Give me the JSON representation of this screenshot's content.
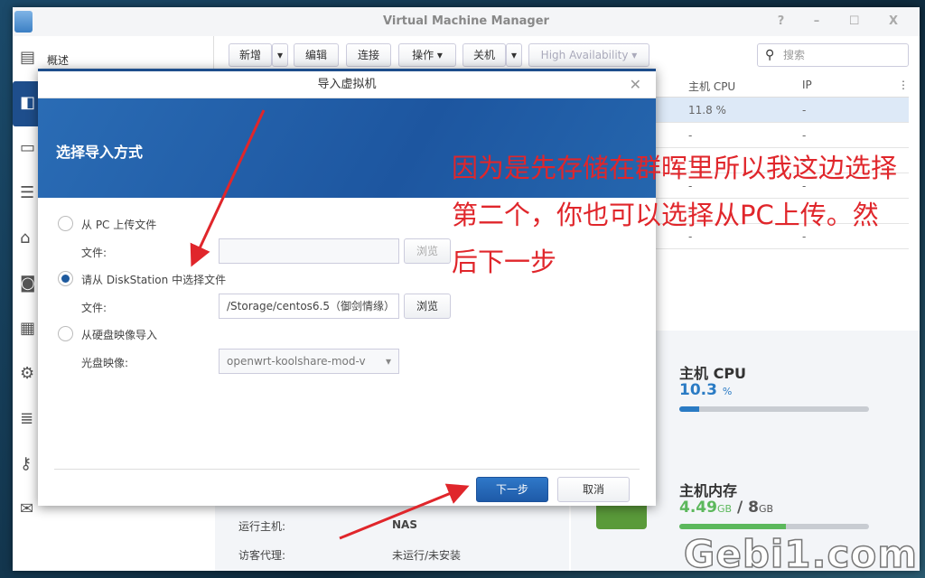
{
  "window": {
    "title": "Virtual Machine Manager",
    "controls": "? – ☐ X"
  },
  "sidebar": {
    "items": [
      {
        "label": "概述",
        "icon": "overview-icon"
      },
      {
        "label": "",
        "icon": "vm-icon"
      },
      {
        "label": "",
        "icon": "laptop-icon"
      },
      {
        "label": "",
        "icon": "storage-icon"
      },
      {
        "label": "",
        "icon": "network-icon"
      },
      {
        "label": "",
        "icon": "image-icon"
      },
      {
        "label": "",
        "icon": "license-icon"
      },
      {
        "label": "",
        "icon": "gear-icon"
      },
      {
        "label": "",
        "icon": "log-icon"
      },
      {
        "label": "",
        "icon": "key-icon"
      },
      {
        "label": "",
        "icon": "mail-icon"
      }
    ]
  },
  "toolbar": {
    "add": "新增",
    "edit": "编辑",
    "connect": "连接",
    "action": "操作 ▾",
    "shutdown": "关机",
    "ha": "High Availability ▾",
    "search_placeholder": "搜索"
  },
  "table": {
    "headers": [
      "主机 CPU",
      "IP"
    ],
    "rows": [
      [
        "11.8 %",
        "-"
      ],
      [
        "-",
        "-"
      ],
      [
        "-",
        "-"
      ],
      [
        "-",
        "-"
      ],
      [
        "-",
        "-"
      ],
      [
        "-",
        "-"
      ]
    ]
  },
  "details": {
    "host_label": "运行主机:",
    "host_value": "NAS",
    "agent_label": "访客代理:",
    "agent_value": "未运行/未安装"
  },
  "stats": {
    "cpu_title": "主机 CPU",
    "cpu_value": "10.3",
    "cpu_unit": "%",
    "cpu_percent": 10.3,
    "mem_title": "主机内存",
    "mem_used": "4.49",
    "mem_unit": "GB",
    "mem_sep": "/",
    "mem_total": "8",
    "mem_total_unit": "GB",
    "mem_percent": 56,
    "cpu_color": "#2a7bc4",
    "mem_color": "#5cb85c"
  },
  "dialog": {
    "title": "导入虚拟机",
    "heading": "选择导入方式",
    "opt1": "从 PC 上传文件",
    "file_label": "文件:",
    "browse": "浏览",
    "opt2": "请从 DiskStation 中选择文件",
    "file2_value": "/Storage/centos6.5（御剑情缘）",
    "opt3": "从硬盘映像导入",
    "iso_label": "光盘映像:",
    "iso_value": "openwrt-koolshare-mod-v",
    "next": "下一步",
    "cancel": "取消"
  },
  "annotation": {
    "text": "因为是先存储在群晖里所以我这边选择第二个，你也可以选择从PC上传。然后下一步",
    "color": "#e0262b"
  },
  "watermark": "Gebi1.com"
}
